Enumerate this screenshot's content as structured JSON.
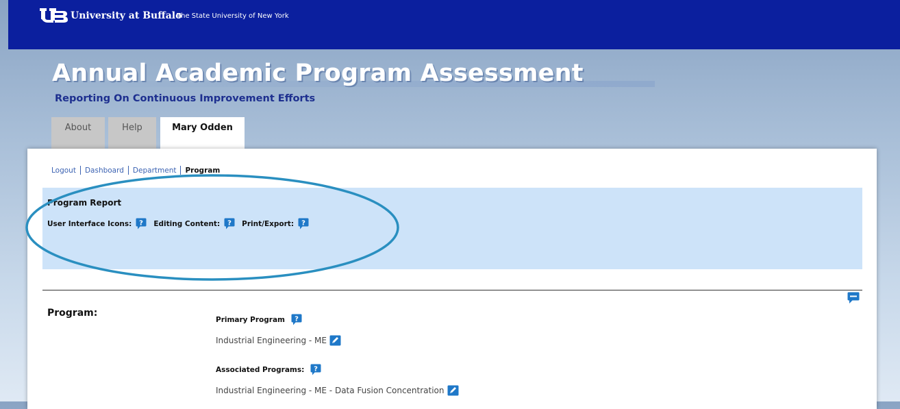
{
  "header": {
    "university": "University at Buffalo",
    "subtitle": "The State University of New York"
  },
  "hero": {
    "title": "Annual Academic Program Assessment",
    "subtitle": "Reporting On Continuous Improvement Efforts"
  },
  "tabs": [
    {
      "label": "About"
    },
    {
      "label": "Help"
    },
    {
      "label": "Mary Odden"
    }
  ],
  "breadcrumb": {
    "logout": "Logout",
    "dashboard": "Dashboard",
    "department": "Department",
    "current": "Program"
  },
  "report": {
    "title": "Program Report",
    "ui_icons_label": "User Interface Icons:",
    "editing_label": "Editing Content:",
    "print_label": "Print/Export:"
  },
  "program": {
    "label": "Program:",
    "primary_heading": "Primary Program",
    "primary_value": "Industrial Engineering - ME",
    "associated_heading": "Associated Programs:",
    "associated_value": "Industrial Engineering - ME - Data Fusion Concentration"
  },
  "icons": {
    "help": "help-question-icon",
    "edit": "pencil-edit-icon",
    "comment": "comment-icon"
  },
  "colors": {
    "ub_blue": "#0b1f9e",
    "report_box": "#cde3f9",
    "annotation_ellipse": "#2a8fc0",
    "help_icon": "#1f78c8"
  }
}
